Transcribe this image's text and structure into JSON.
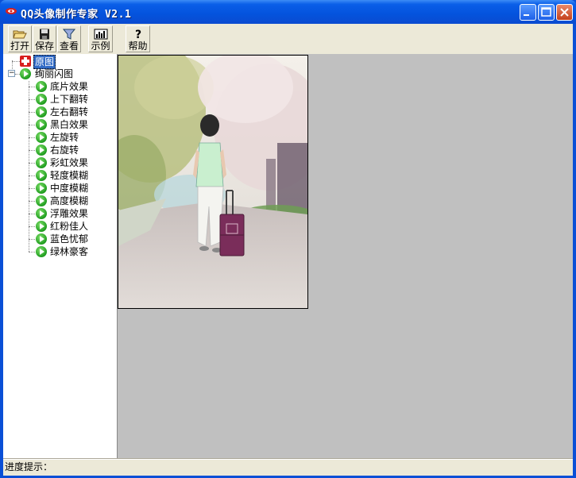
{
  "window": {
    "title": "QQ头像制作专家 V2.1"
  },
  "toolbar": {
    "open": "打开",
    "save": "保存",
    "view": "查看",
    "example": "示例",
    "help": "帮助"
  },
  "tree": {
    "original": "原图",
    "group": "绚丽闪图",
    "expander": "−",
    "items": [
      "底片效果",
      "上下翻转",
      "左右翻转",
      "黑白效果",
      "左旋转",
      "右旋转",
      "彩虹效果",
      "轻度模糊",
      "中度模糊",
      "高度模糊",
      "浮雕效果",
      "红粉佳人",
      "蓝色忧郁",
      "绿林豪客"
    ]
  },
  "status": {
    "label": "进度提示："
  },
  "icons": {
    "app": "app-logo-icon",
    "open": "folder-open-icon",
    "save": "floppy-disk-icon",
    "view": "funnel-view-icon",
    "example": "chart-example-icon",
    "help": "question-mark-icon",
    "original": "red-cross-icon",
    "effect": "green-play-icon"
  }
}
